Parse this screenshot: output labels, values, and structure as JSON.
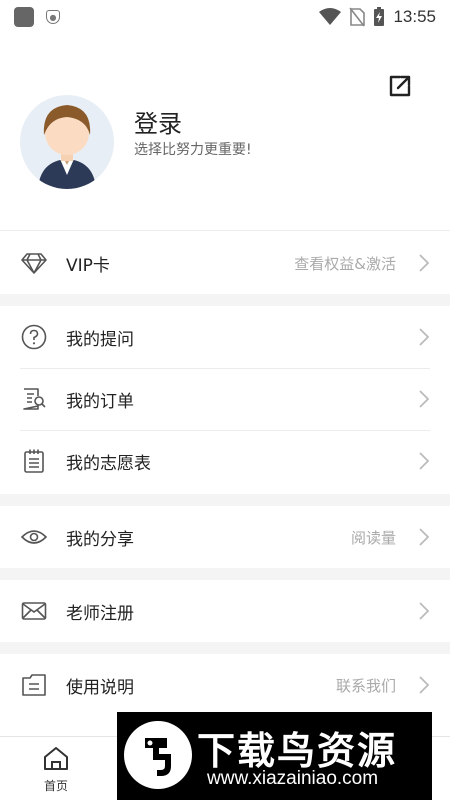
{
  "status_bar": {
    "time": "13:55"
  },
  "profile": {
    "title": "登录",
    "subtitle": "选择比努力更重要!"
  },
  "menu": {
    "vip": {
      "label": "VIP卡",
      "extra": "查看权益&激活"
    },
    "questions": {
      "label": "我的提问"
    },
    "orders": {
      "label": "我的订单"
    },
    "wishlist": {
      "label": "我的志愿表"
    },
    "share": {
      "label": "我的分享",
      "extra": "阅读量"
    },
    "teacher": {
      "label": "老师注册"
    },
    "instructions": {
      "label": "使用说明",
      "extra": "联系我们"
    }
  },
  "bottom_nav": {
    "home_label": "首页"
  },
  "watermark": {
    "text": "下载鸟资源",
    "url": "www.xiazainiao.com"
  }
}
